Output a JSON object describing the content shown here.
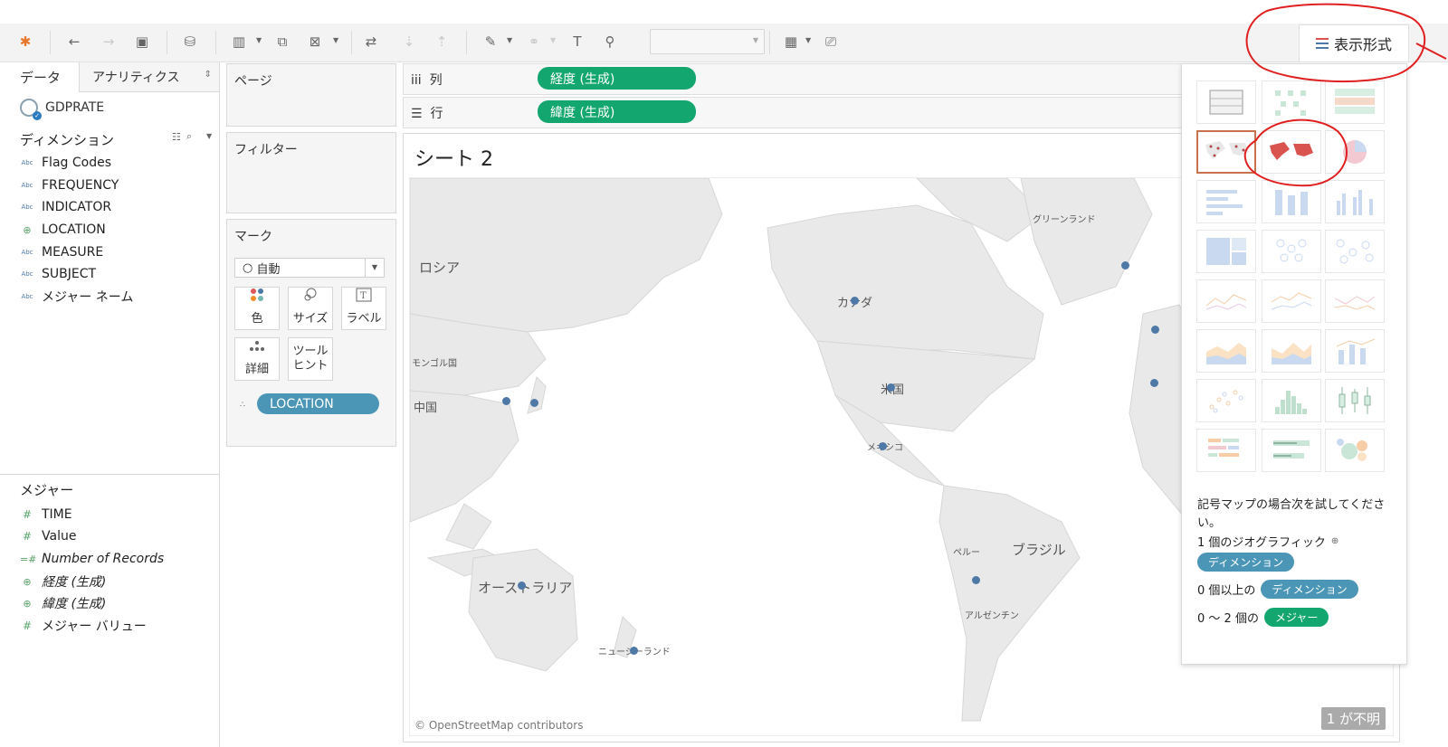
{
  "toolbar": {
    "icons": [
      "tableau-logo-icon",
      "undo-icon",
      "redo-icon",
      "save-icon",
      "new-datasource-icon",
      "new-worksheet-icon",
      "duplicate-icon",
      "clear-icon",
      "swap-icon",
      "sort-asc-icon",
      "sort-desc-icon",
      "highlight-icon",
      "group-icon",
      "label-icon",
      "pin-icon",
      "fit-dropdown",
      "show-cards-icon",
      "presentation-icon"
    ],
    "show_me_label": "表示形式"
  },
  "left_pane": {
    "tab_data": "データ",
    "tab_analytics": "アナリティクス",
    "datasource": "GDPRATE",
    "dimensions_title": "ディメンション",
    "dimensions": [
      {
        "type": "Abc",
        "name": "Flag Codes"
      },
      {
        "type": "Abc",
        "name": "FREQUENCY"
      },
      {
        "type": "Abc",
        "name": "INDICATOR"
      },
      {
        "type": "globe",
        "name": "LOCATION"
      },
      {
        "type": "Abc",
        "name": "MEASURE"
      },
      {
        "type": "Abc",
        "name": "SUBJECT"
      },
      {
        "type": "Abc",
        "name": "メジャー ネーム"
      }
    ],
    "measures_title": "メジャー",
    "measures": [
      {
        "type": "#",
        "name": "TIME"
      },
      {
        "type": "#",
        "name": "Value"
      },
      {
        "type": "=#",
        "name": "Number of Records"
      },
      {
        "type": "globe",
        "name": "経度 (生成)"
      },
      {
        "type": "globe",
        "name": "緯度 (生成)"
      },
      {
        "type": "#",
        "name": "メジャー バリュー"
      }
    ]
  },
  "cards": {
    "pages_title": "ページ",
    "filters_title": "フィルター",
    "marks_title": "マーク",
    "marks_type": "自動",
    "marks_buttons": [
      {
        "label": "色",
        "icon": "color-icon"
      },
      {
        "label": "サイズ",
        "icon": "size-icon"
      },
      {
        "label": "ラベル",
        "icon": "label-icon"
      },
      {
        "label": "詳細",
        "icon": "detail-icon"
      },
      {
        "label": "ツール\nヒント",
        "icon": "tooltip-icon"
      }
    ],
    "marks_pill": "LOCATION"
  },
  "shelves": {
    "columns_label": "列",
    "columns_pill": "経度 (生成)",
    "rows_label": "行",
    "rows_pill": "緯度 (生成)"
  },
  "view": {
    "sheet_title": "シート 2",
    "credit": "© OpenStreetMap contributors",
    "unknown_badge": "1 が不明",
    "labels": [
      "ロシア",
      "モンゴル国",
      "中国",
      "カナダ",
      "米国",
      "メキシコ",
      "グリーンランド",
      "ブラジル",
      "ペルー",
      "アルゼンチン",
      "オーストラリア",
      "ニュージーランド"
    ]
  },
  "showme": {
    "hint_title": "記号マップの場合次を試してください。",
    "line1_prefix": "1 個のジオグラフィック",
    "line1_pill": "ディメンション",
    "line2_prefix": "0 個以上の",
    "line2_pill": "ディメンション",
    "line3_prefix": "0 〜 2 個の",
    "line3_pill": "メジャー"
  }
}
